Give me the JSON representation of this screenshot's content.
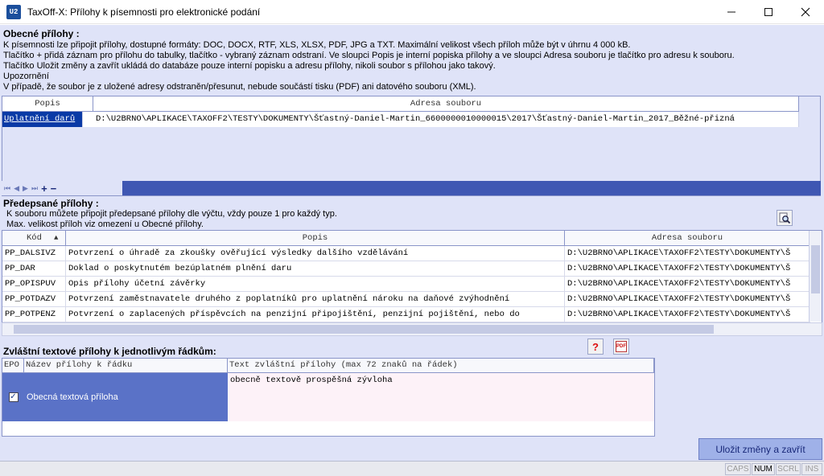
{
  "window": {
    "app_icon_text": "U2",
    "title": "TaxOff-X: Přílohy k písemnosti pro elektronické podání"
  },
  "general": {
    "title": "Obecné přílohy :",
    "info_lines": [
      "K písemnosti lze připojit přílohy, dostupné formáty: DOC, DOCX, RTF, XLS, XLSX, PDF, JPG a TXT. Maximální velikost všech příloh může být v úhrnu 4 000 kB.",
      "Tlačítko + přidá záznam pro přílohu do tabulky, tlačítko - vybraný záznam odstraní. Ve sloupci Popis je interní popiska přílohy a ve sloupci Adresa souboru je tlačítko pro adresu k souboru.",
      "Tlačítko Uložit změny a zavřít ukládá do databáze pouze interní popisku a adresu přílohy, nikoli soubor s přílohou jako takový.",
      "Upozornění",
      "V případě, že soubor je z uložené adresy odstraněn/přesunut, nebude součástí tisku (PDF) ani datového souboru (XML)."
    ],
    "columns": [
      "Popis",
      "Adresa souboru"
    ],
    "rows": [
      {
        "popis": "Uplatnění darů",
        "adresa": "D:\\U2BRNO\\APLIKACE\\TAXOFF2\\TESTY\\DOKUMENTY\\Šťastný-Daniel-Martin_6600000010000015\\2017\\Šťastný-Daniel-Martin_2017_Běžné-přizná"
      }
    ],
    "nav": {
      "first": "⏮",
      "prev": "◀",
      "next": "▶",
      "last": "⏭",
      "add": "+",
      "remove": "−"
    }
  },
  "prescribed": {
    "title": "Předepsané přílohy :",
    "info_lines": [
      "K souboru můžete připojit předepsané přílohy dle výčtu, vždy pouze 1 pro každý typ.",
      "Max. velikost příloh viz omezení u Obecné přílohy."
    ],
    "columns": {
      "kod": "Kód",
      "popis": "Popis",
      "adresa": "Adresa souboru"
    },
    "sort_indicator": "▲",
    "rows": [
      {
        "kod": "PP_DALSIVZ",
        "popis": "Potvrzení o úhradě za zkoušky ověřující výsledky dalšího vzdělávání",
        "adresa": "D:\\U2BRNO\\APLIKACE\\TAXOFF2\\TESTY\\DOKUMENTY\\Š"
      },
      {
        "kod": "PP_DAR",
        "popis": "Doklad o poskytnutém bezúplatném plnění daru",
        "adresa": "D:\\U2BRNO\\APLIKACE\\TAXOFF2\\TESTY\\DOKUMENTY\\Š"
      },
      {
        "kod": "PP_OPISPUV",
        "popis": "Opis přílohy účetní závěrky",
        "adresa": "D:\\U2BRNO\\APLIKACE\\TAXOFF2\\TESTY\\DOKUMENTY\\Š"
      },
      {
        "kod": "PP_POTDAZV",
        "popis": "Potvrzení zaměstnavatele druhého z poplatníků pro uplatnění nároku na daňové zvýhodnění",
        "adresa": "D:\\U2BRNO\\APLIKACE\\TAXOFF2\\TESTY\\DOKUMENTY\\Š"
      },
      {
        "kod": "PP_POTPENZ",
        "popis": "Potvrzení o zaplacených příspěvcích na penzijní připojištění, penzijní pojištění, nebo do",
        "adresa": "D:\\U2BRNO\\APLIKACE\\TAXOFF2\\TESTY\\DOKUMENTY\\Š"
      }
    ]
  },
  "special": {
    "title": "Zvláštní textové přílohy k jednotlivým řádkům:",
    "columns": {
      "epo": "EPO",
      "name": "Název přílohy k řádku",
      "text": "Text zvláštní přílohy (max 72 znaků na řádek)"
    },
    "rows": [
      {
        "checked": "✓",
        "name": "Obecná textová příloha",
        "text": "obecně textově prospěšná zývloha"
      }
    ],
    "help_icon_glyph": "?",
    "pdf_icon_text": "PDF"
  },
  "actions": {
    "save_label": "Uložit změny a zavřít"
  },
  "statusbar": {
    "caps": "CAPS",
    "num": "NUM",
    "scrl": "SCRL",
    "ins": "INS"
  }
}
